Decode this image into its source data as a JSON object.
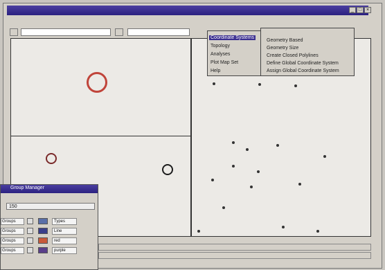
{
  "window": {
    "title": "",
    "buttons": [
      "_",
      "□",
      "×"
    ]
  },
  "menubar": {
    "items": [
      "",
      "",
      "",
      "",
      "",
      ""
    ],
    "active_label": ""
  },
  "toolbar": {
    "left_field": "",
    "mid_field": ""
  },
  "dropdown": {
    "items": [
      "Coordinate Systems",
      "Topology",
      "Analyses",
      "Plot Map Set",
      "Help"
    ],
    "highlighted_index": 0
  },
  "submenu": {
    "header": "",
    "items": [
      "Geometry Based",
      "Geometry Size",
      "Create Closed Polylines",
      "Define Global Coordinate System",
      "Assign Global Coordinate System"
    ]
  },
  "panel": {
    "title": "Group Manager",
    "field_value": "150",
    "rows": [
      {
        "label": "Groups",
        "color": "#5a6fa8",
        "name": "Types"
      },
      {
        "label": "Groups",
        "color": "#3a3f8a",
        "name": "Line"
      },
      {
        "label": "Groups",
        "color": "#c85a3a",
        "name": "red"
      },
      {
        "label": "Groups",
        "color": "#5a3f8a",
        "name": "purple"
      }
    ]
  },
  "colors": {
    "title_bar": "#2b2180",
    "canvas_bg": "#eceae6",
    "ring_red": "#c0443a",
    "ring_dark_red": "#7a2a2a",
    "ring_black": "#1c1c1c"
  }
}
